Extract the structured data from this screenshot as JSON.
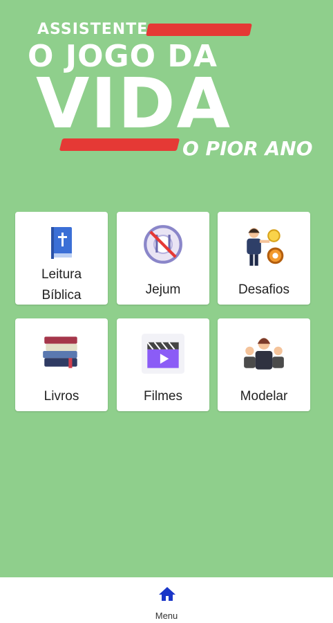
{
  "logo": {
    "line1": "ASSISTENTE",
    "line2": "O JOGO DA",
    "line3": "VIDA",
    "line4": "O PIOR ANO",
    "colors": {
      "text": "#ffffff",
      "accent": "#e53935"
    }
  },
  "grid": {
    "cards": [
      {
        "label": "Leitura Bíblica",
        "icon": "bible-icon"
      },
      {
        "label": "Jejum",
        "icon": "no-food-icon"
      },
      {
        "label": "Desafios",
        "icon": "challenges-icon"
      },
      {
        "label": "Livros",
        "icon": "books-icon"
      },
      {
        "label": "Filmes",
        "icon": "clapperboard-icon"
      },
      {
        "label": "Modelar",
        "icon": "mentor-icon"
      }
    ]
  },
  "nav": {
    "label": "Menu",
    "icon": "home-icon"
  },
  "colors": {
    "background": "#8fcf8c",
    "card": "#ffffff",
    "nav_icon": "#1a36c8"
  }
}
